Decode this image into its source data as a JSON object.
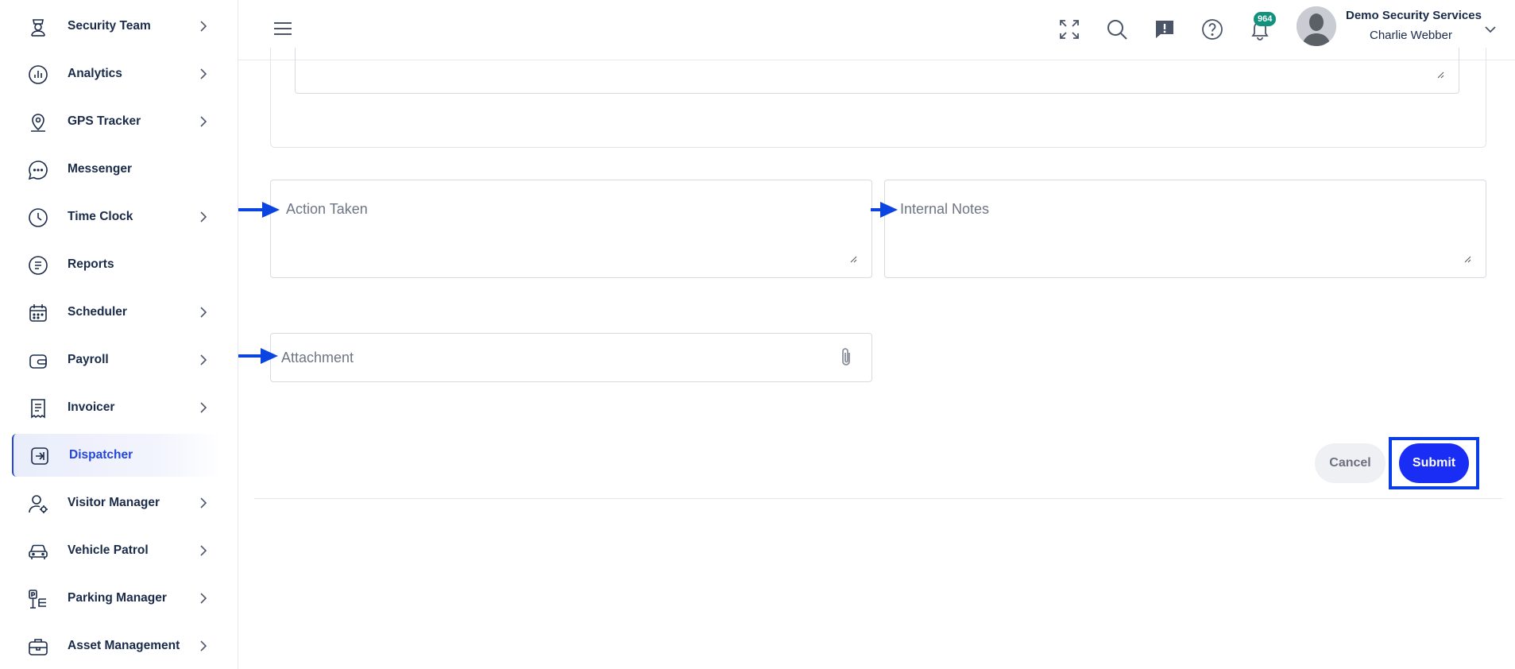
{
  "sidebar": {
    "items": [
      {
        "label": "Security Team",
        "icon": "guard-icon",
        "has_chevron": true
      },
      {
        "label": "Analytics",
        "icon": "analytics-icon",
        "has_chevron": true
      },
      {
        "label": "GPS Tracker",
        "icon": "map-pin-icon",
        "has_chevron": true
      },
      {
        "label": "Messenger",
        "icon": "chat-bubble-icon",
        "has_chevron": false
      },
      {
        "label": "Time Clock",
        "icon": "clock-icon",
        "has_chevron": true
      },
      {
        "label": "Reports",
        "icon": "reports-icon",
        "has_chevron": false
      },
      {
        "label": "Scheduler",
        "icon": "calendar-icon",
        "has_chevron": true
      },
      {
        "label": "Payroll",
        "icon": "wallet-icon",
        "has_chevron": true
      },
      {
        "label": "Invoicer",
        "icon": "receipt-icon",
        "has_chevron": true
      },
      {
        "label": "Dispatcher",
        "icon": "dispatch-icon",
        "has_chevron": false,
        "active": true
      },
      {
        "label": "Visitor Manager",
        "icon": "visitor-icon",
        "has_chevron": true
      },
      {
        "label": "Vehicle Patrol",
        "icon": "car-icon",
        "has_chevron": true
      },
      {
        "label": "Parking Manager",
        "icon": "parking-icon",
        "has_chevron": true
      },
      {
        "label": "Asset Management",
        "icon": "briefcase-icon",
        "has_chevron": true
      }
    ]
  },
  "header": {
    "notification_count": "964",
    "org_name": "Demo Security Services",
    "user_name": "Charlie Webber"
  },
  "form": {
    "action_taken_placeholder": "Action Taken",
    "internal_notes_placeholder": "Internal Notes",
    "attachment_placeholder": "Attachment",
    "cancel_label": "Cancel",
    "submit_label": "Submit"
  },
  "colors": {
    "accent": "#2345d8",
    "submit": "#1a2df5",
    "highlight_outline": "#0a3de3",
    "badge": "#12917d",
    "arrow": "#0b44e0"
  }
}
